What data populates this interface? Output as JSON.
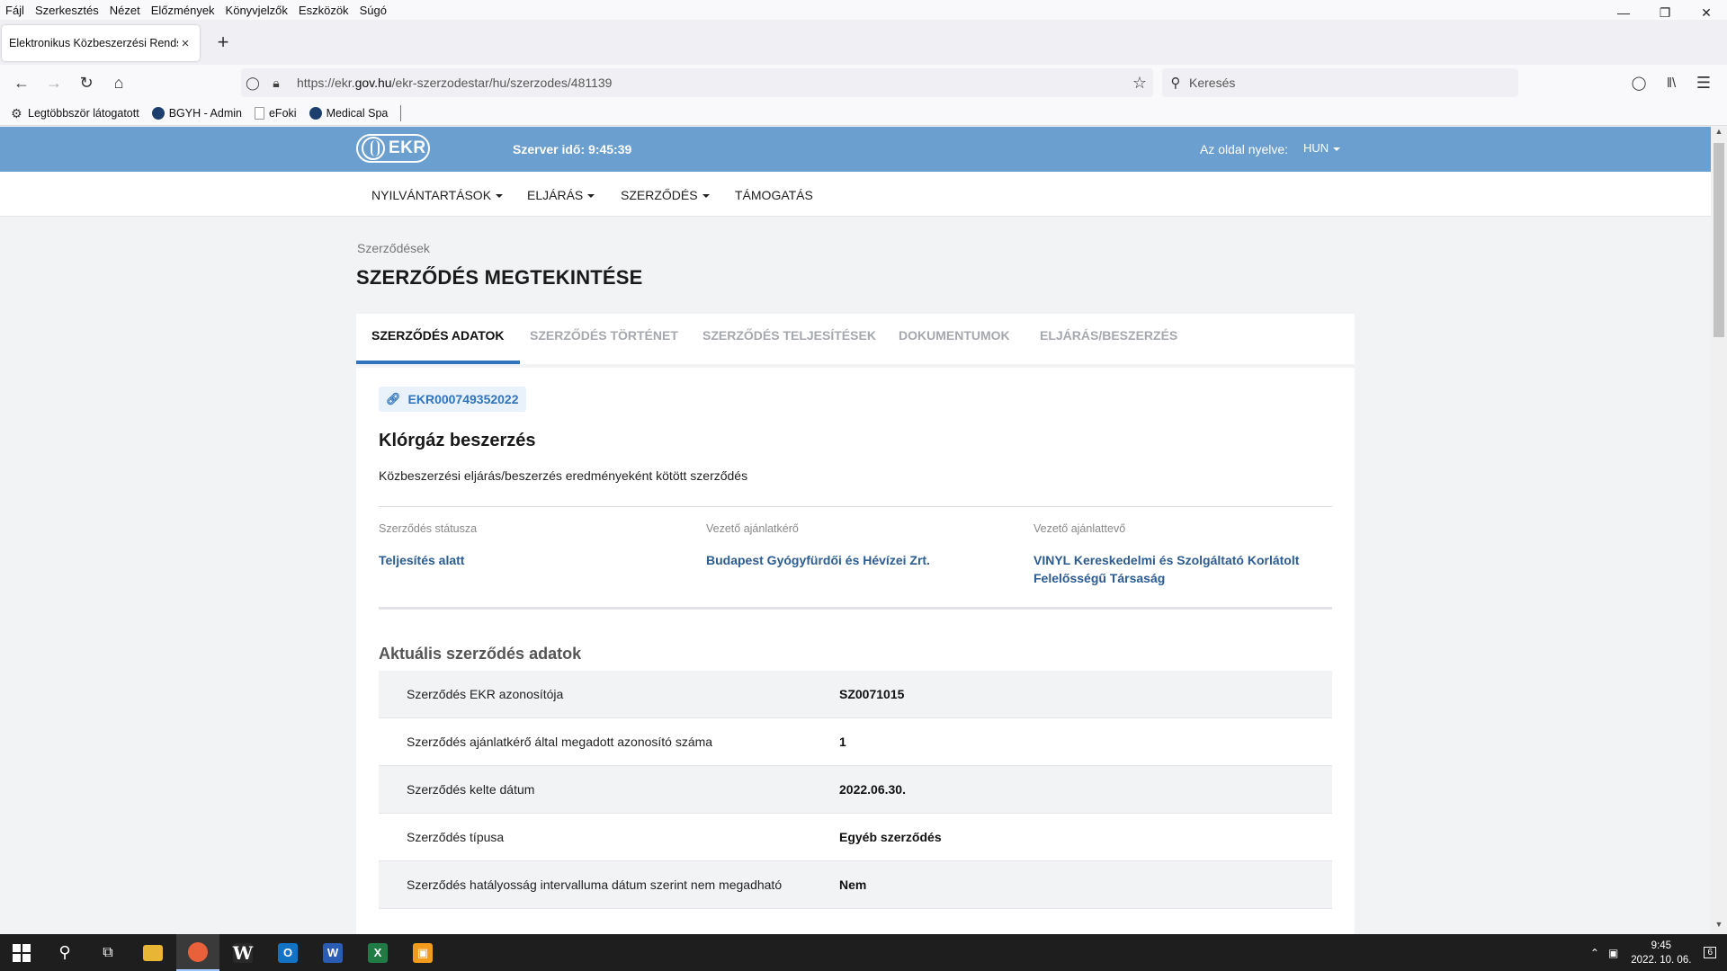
{
  "browser": {
    "menu": [
      "Fájl",
      "Szerkesztés",
      "Nézet",
      "Előzmények",
      "Könyvjelzők",
      "Eszközök",
      "Súgó"
    ],
    "tab_title": "Elektronikus Közbeszerzési Rendszer",
    "url_prefix": "https://ekr.",
    "url_domain": "gov.hu",
    "url_path": "/ekr-szerzodestar/hu/szerzodes/481139",
    "search_placeholder": "Keresés",
    "bookmarks": [
      "Legtöbbször látogatott",
      "BGYH - Admin",
      "eFoki",
      "Medical Spa"
    ]
  },
  "header": {
    "logo_text": "EKR",
    "server_time": "Szerver idő: 9:45:39",
    "lang_label": "Az oldal nyelve:",
    "lang_value": "HUN"
  },
  "nav": [
    "NYILVÁNTARTÁSOK",
    "ELJÁRÁS",
    "SZERZŐDÉS",
    "TÁMOGATÁS"
  ],
  "breadcrumb": "Szerződések",
  "page_title": "SZERZŐDÉS MEGTEKINTÉSE",
  "tabs": [
    "SZERZŐDÉS ADATOK",
    "SZERZŐDÉS TÖRTÉNET",
    "SZERZŐDÉS TELJESÍTÉSEK",
    "DOKUMENTUMOK",
    "ELJÁRÁS/BESZERZÉS"
  ],
  "contract": {
    "ekr_id": "EKR000749352022",
    "title": "Klórgáz beszerzés",
    "subtitle": "Közbeszerzési eljárás/beszerzés eredményeként kötött szerződés",
    "info": [
      {
        "label": "Szerződés státusza",
        "value": "Teljesítés alatt"
      },
      {
        "label": "Vezető ajánlatkérő",
        "value": "Budapest Gyógyfürdői és Hévízei Zrt."
      },
      {
        "label": "Vezető ajánlattevő",
        "value": "VINYL Kereskedelmi és Szolgáltató Korlátolt Felelősségű Társaság"
      }
    ],
    "section_title": "Aktuális szerződés adatok",
    "rows": [
      {
        "key": "Szerződés EKR azonosítója",
        "value": "SZ0071015"
      },
      {
        "key": "Szerződés ajánlatkérő által megadott azonosító száma",
        "value": "1"
      },
      {
        "key": "Szerződés kelte dátum",
        "value": "2022.06.30."
      },
      {
        "key": "Szerződés típusa",
        "value": "Egyéb szerződés"
      },
      {
        "key": "Szerződés hatályosság intervalluma dátum szerint nem megadható",
        "value": "Nem"
      }
    ]
  },
  "taskbar": {
    "time": "9:45",
    "date": "2022. 10. 06.",
    "notifications": "6"
  }
}
